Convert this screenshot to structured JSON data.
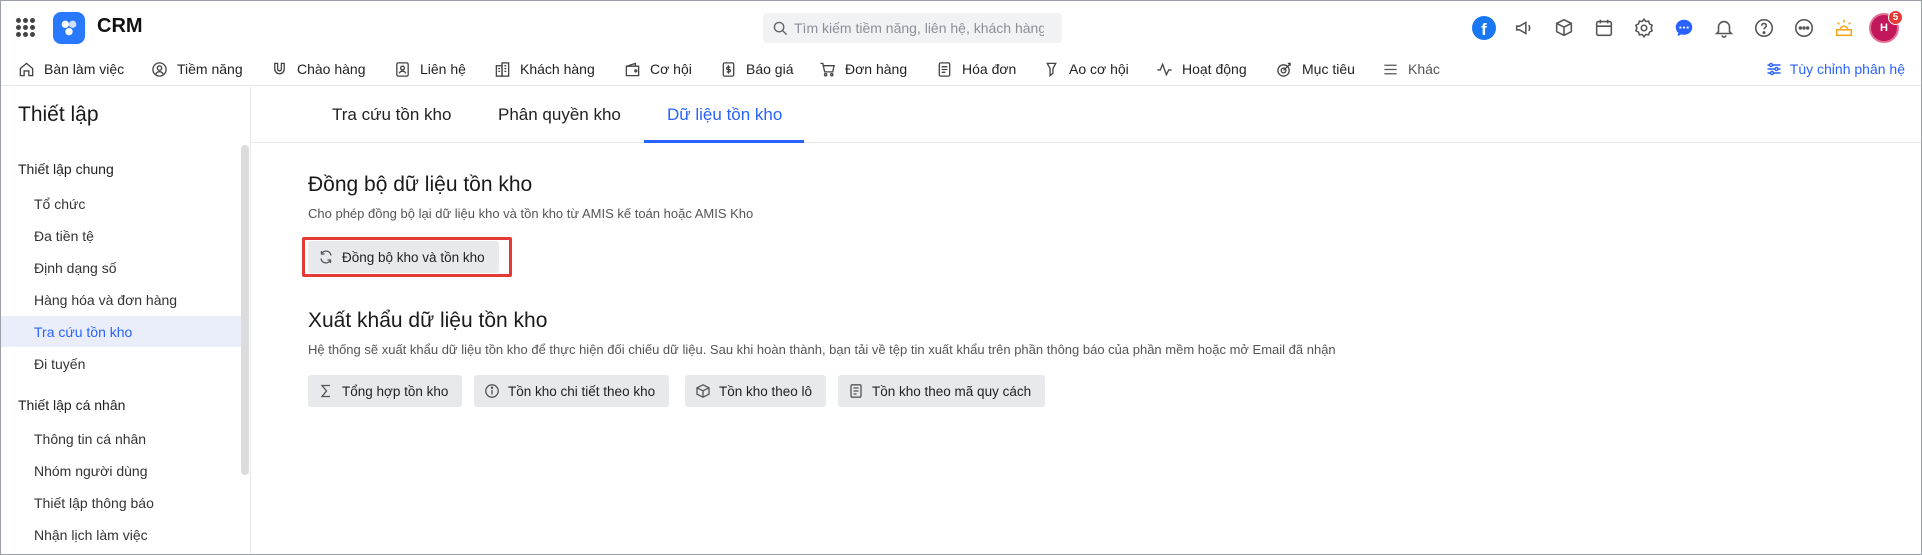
{
  "app": {
    "name": "CRM"
  },
  "search": {
    "placeholder": "Tìm kiếm tiềm năng, liên hệ, khách hàng"
  },
  "top_icons": [
    "facebook-icon",
    "megaphone-icon",
    "box-search-icon",
    "calendar-icon",
    "gear-icon",
    "chat-icon",
    "bell-icon",
    "help-icon",
    "more-icon",
    "idea-icon"
  ],
  "facebook_letter": "f",
  "avatar": {
    "initials": "H",
    "badge": "5"
  },
  "nav": {
    "items": [
      {
        "label": "Bàn làm việc"
      },
      {
        "label": "Tiềm năng"
      },
      {
        "label": "Chào hàng"
      },
      {
        "label": "Liên hệ"
      },
      {
        "label": "Khách hàng"
      },
      {
        "label": "Cơ hội"
      },
      {
        "label": "Báo giá"
      },
      {
        "label": "Đơn hàng"
      },
      {
        "label": "Hóa đơn"
      },
      {
        "label": "Ao cơ hội"
      },
      {
        "label": "Hoạt động"
      },
      {
        "label": "Mục tiêu"
      },
      {
        "label": "Khác"
      }
    ],
    "customize": "Tùy chỉnh phân hệ"
  },
  "sidebar": {
    "title": "Thiết lập",
    "section_general": "Thiết lập chung",
    "general_items": [
      {
        "label": "Tổ chức"
      },
      {
        "label": "Đa tiền tệ"
      },
      {
        "label": "Định dạng số"
      },
      {
        "label": "Hàng hóa và đơn hàng"
      },
      {
        "label": "Tra cứu tồn kho"
      },
      {
        "label": "Đi tuyến"
      }
    ],
    "section_personal": "Thiết lập cá nhân",
    "personal_items": [
      {
        "label": "Thông tin cá nhân"
      },
      {
        "label": "Nhóm người dùng"
      },
      {
        "label": "Thiết lập thông báo"
      },
      {
        "label": "Nhận lịch làm việc"
      }
    ]
  },
  "tabs": [
    {
      "label": "Tra cứu tồn kho"
    },
    {
      "label": "Phân quyền kho"
    },
    {
      "label": "Dữ liệu tồn kho"
    }
  ],
  "sync": {
    "title": "Đồng bộ dữ liệu tồn kho",
    "desc": "Cho phép đồng bộ lại dữ liệu kho và tồn kho từ AMIS kế toán hoặc AMIS Kho",
    "button": "Đồng bộ kho và tồn kho"
  },
  "export": {
    "title": "Xuất khẩu dữ liệu tồn kho",
    "desc": "Hệ thống sẽ xuất khẩu dữ liệu tồn kho để thực hiện đối chiếu dữ liệu. Sau khi hoàn thành, bạn tải về tệp tin xuất khẩu trên phần thông báo của phần mềm hoặc mở Email đã nhận",
    "buttons": [
      {
        "label": "Tổng hợp tồn kho"
      },
      {
        "label": "Tồn kho chi tiết theo kho"
      },
      {
        "label": "Tồn kho theo lô"
      },
      {
        "label": "Tồn kho theo mã quy cách"
      }
    ]
  },
  "colors": {
    "accent": "#2962ff",
    "brand": "#2979ff",
    "highlight": "#e53935"
  }
}
